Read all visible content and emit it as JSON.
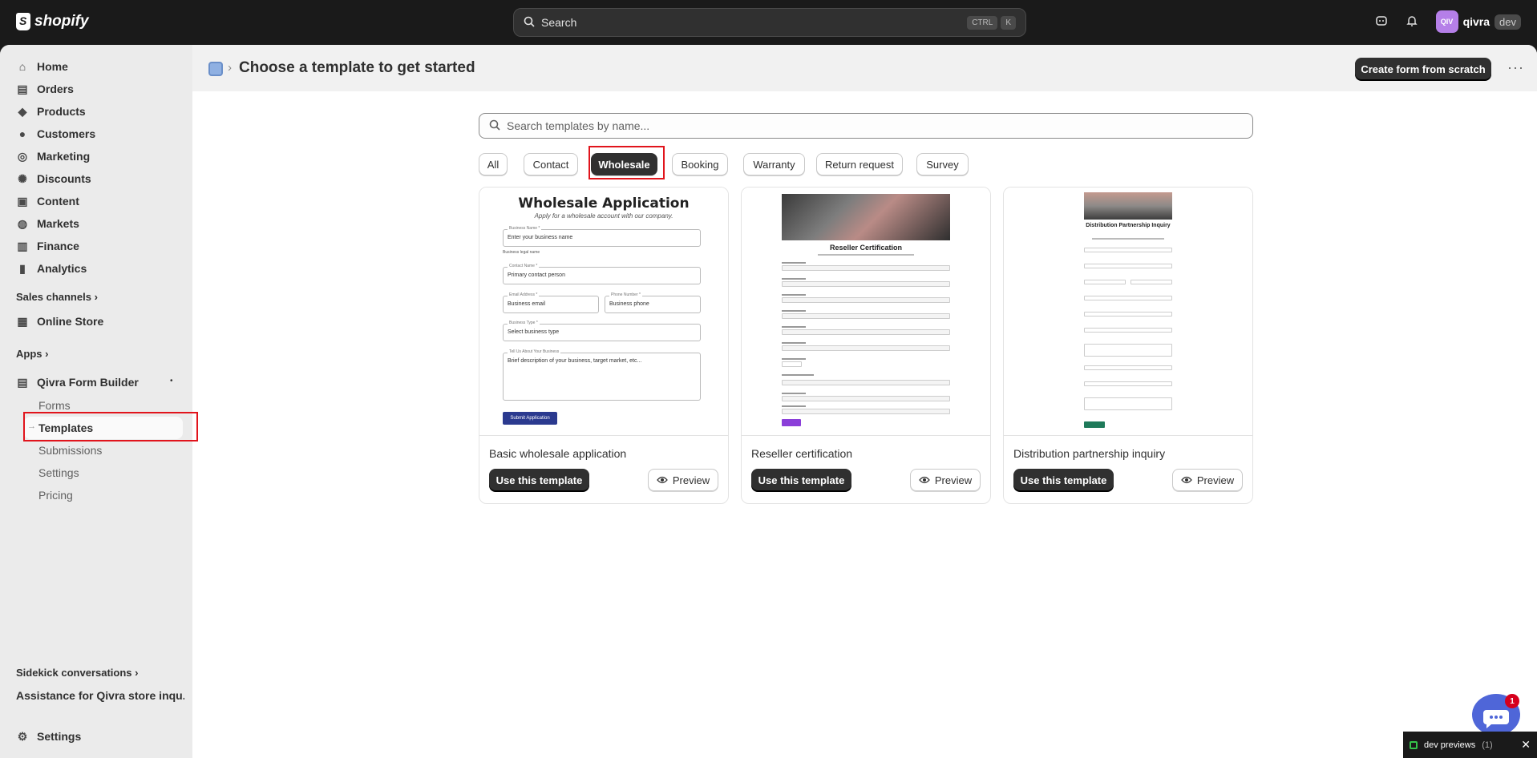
{
  "topbar": {
    "brand": "shopify",
    "search_label": "Search",
    "kbd": [
      "CTRL",
      "K"
    ],
    "avatar_initials": "QIV",
    "store_name": "qivra",
    "store_badge": "dev"
  },
  "sidebar": {
    "items": [
      {
        "label": "Home",
        "icon": "home-icon"
      },
      {
        "label": "Orders",
        "icon": "inbox-icon"
      },
      {
        "label": "Products",
        "icon": "tag-icon"
      },
      {
        "label": "Customers",
        "icon": "person-icon"
      },
      {
        "label": "Marketing",
        "icon": "target-icon"
      },
      {
        "label": "Discounts",
        "icon": "discount-icon"
      },
      {
        "label": "Content",
        "icon": "content-icon"
      },
      {
        "label": "Markets",
        "icon": "globe-icon"
      },
      {
        "label": "Finance",
        "icon": "bank-icon"
      },
      {
        "label": "Analytics",
        "icon": "chart-icon"
      }
    ],
    "sales_channels": "Sales channels",
    "online_store": "Online Store",
    "apps": "Apps",
    "app_name": "Qivra Form Builder",
    "app_sub": [
      "Forms",
      "Templates",
      "Submissions",
      "Settings",
      "Pricing"
    ],
    "sidekick": "Sidekick conversations",
    "sidekick_item": "Assistance for Qivra store inqu...",
    "settings": "Settings"
  },
  "header": {
    "title": "Choose a template to get started",
    "create_button": "Create form from scratch",
    "more": "···"
  },
  "template_search": {
    "placeholder": "Search templates by name..."
  },
  "filters": [
    "All",
    "Contact",
    "Wholesale",
    "Booking",
    "Warranty",
    "Return request",
    "Survey"
  ],
  "active_filter": "Wholesale",
  "cards": [
    {
      "title": "Basic wholesale application",
      "use": "Use this template",
      "preview": "Preview"
    },
    {
      "title": "Reseller certification",
      "use": "Use this template",
      "preview": "Preview"
    },
    {
      "title": "Distribution partnership inquiry",
      "use": "Use this template",
      "preview": "Preview"
    }
  ],
  "thumb1": {
    "title": "Wholesale Application",
    "subtitle": "Apply for a wholesale account with our company.",
    "f1_label": "Business Name *",
    "f1": "Enter your business name",
    "f1_help": "Business legal name",
    "f2_label": "Contact Name *",
    "f2": "Primary contact person",
    "f3_label": "Email Address *",
    "f3": "Business email",
    "f4_label": "Phone Number *",
    "f4": "Business phone",
    "f5_label": "Business Type *",
    "f5": "Select business type",
    "f6_label": "Tell Us About Your Business",
    "f6": "Brief description of your business, target market, etc...",
    "submit": "Submit Application"
  },
  "thumb2": {
    "title": "Reseller Certification"
  },
  "thumb3": {
    "title": "Distribution Partnership Inquiry"
  },
  "chat_badge": "1",
  "devbar": {
    "label": "dev previews",
    "count": "(1)"
  }
}
